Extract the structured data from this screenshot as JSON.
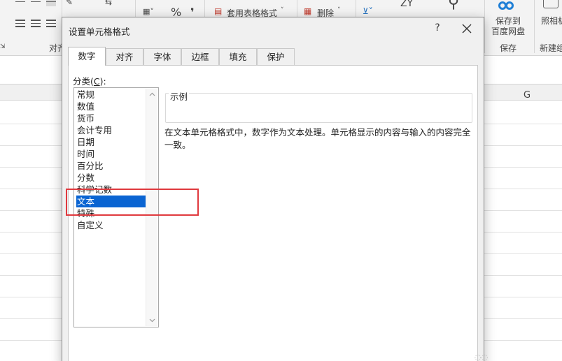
{
  "ribbon": {
    "group_align_label": "对齐",
    "group_save_label": "保存",
    "group_new_label": "新建组",
    "table_format_label": "套用表格格式",
    "delete_label": "删除",
    "save_to_baidu_line1": "保存到",
    "save_to_baidu_line2": "百度网盘",
    "photo_label": "照相机",
    "percent_symbol": "%",
    "comma_symbol": "❜"
  },
  "sheet": {
    "column_g": "G"
  },
  "dialog": {
    "title": "设置单元格格式",
    "help_label": "?",
    "tabs": [
      {
        "label": "数字"
      },
      {
        "label": "对齐"
      },
      {
        "label": "字体"
      },
      {
        "label": "边框"
      },
      {
        "label": "填充"
      },
      {
        "label": "保护"
      }
    ],
    "active_tab": "数字",
    "category_label_prefix": "分类(",
    "category_label_key": "C",
    "category_label_suffix": "):",
    "categories": [
      {
        "label": "常规"
      },
      {
        "label": "数值"
      },
      {
        "label": "货币"
      },
      {
        "label": "会计专用"
      },
      {
        "label": "日期"
      },
      {
        "label": "时间"
      },
      {
        "label": "百分比"
      },
      {
        "label": "分数"
      },
      {
        "label": "科学记数"
      },
      {
        "label": "文本"
      },
      {
        "label": "特殊"
      },
      {
        "label": "自定义"
      }
    ],
    "selected_category": "文本",
    "sample_label": "示例",
    "sample_value": "",
    "description": "在文本单元格格式中，数字作为文本处理。单元格显示的内容与输入的内容完全一致。"
  },
  "colors": {
    "selection": "#0a64d2",
    "annotation_red": "#e0393e",
    "dialog_bg": "#f0f0f0"
  }
}
